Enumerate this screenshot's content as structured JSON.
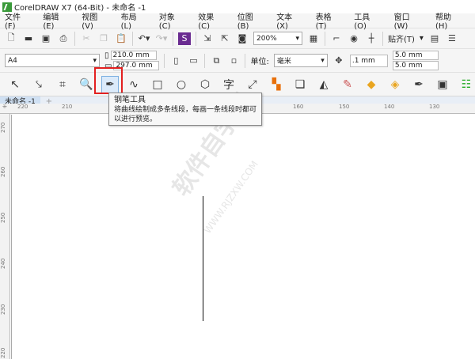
{
  "title": "CorelDRAW X7 (64-Bit) - 未命名 -1",
  "menu": [
    "文件(F)",
    "编辑(E)",
    "视图(V)",
    "布局(L)",
    "对象(C)",
    "效果(C)",
    "位图(B)",
    "文本(X)",
    "表格(T)",
    "工具(O)",
    "窗口(W)",
    "帮助(H)"
  ],
  "toolbar": {
    "zoom": "200%",
    "snap": "贴齐(T)"
  },
  "property_bar": {
    "page_size": "A4",
    "width": "210.0 mm",
    "height": "297.0 mm",
    "unit_label": "单位:",
    "unit": "毫米",
    "nudge": ".1 mm",
    "dup_x": "5.0 mm",
    "dup_y": "5.0 mm"
  },
  "tooltip": {
    "title": "钢笔工具",
    "desc": "将曲线绘制成多条线段，每画一条线段时都可以进行预览。"
  },
  "document_tab": "未命名 -1",
  "ruler_h": [
    "220",
    "210",
    "160",
    "150",
    "140",
    "130"
  ],
  "ruler_v": [
    "270",
    "260",
    "250",
    "240",
    "230",
    "220"
  ],
  "watermark": {
    "text": "软件自学网",
    "url": "WWW.RJZXW.COM"
  }
}
